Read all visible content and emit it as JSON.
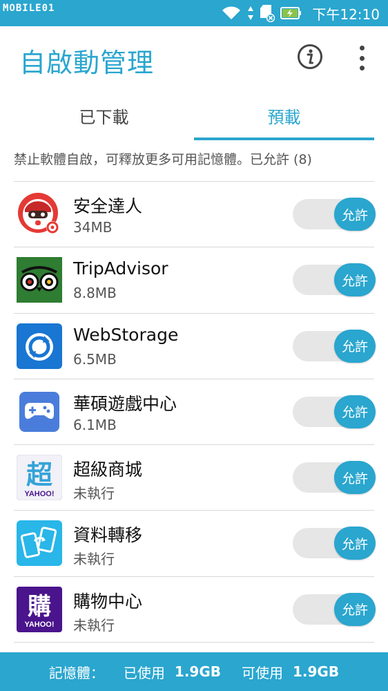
{
  "status_bar": {
    "watermark": "MOBILE01",
    "time": "下午12:10",
    "icons": [
      "wifi-icon",
      "data-arrows-icon",
      "sd-card-icon",
      "battery-charging-icon"
    ]
  },
  "header": {
    "title": "自啟動管理",
    "info_icon": "info-icon",
    "more_icon": "more-vert-icon"
  },
  "tabs": [
    {
      "label": "已下載",
      "active": false
    },
    {
      "label": "預載",
      "active": true
    }
  ],
  "description": "禁止軟體自啟，可釋放更多可用記憶體。已允許 (8)",
  "apps": [
    {
      "name": "安全達人",
      "size": "34MB",
      "toggle_label": "允許",
      "allowed": true,
      "icon": "security-app-icon"
    },
    {
      "name": "TripAdvisor",
      "size": "8.8MB",
      "toggle_label": "允許",
      "allowed": true,
      "icon": "tripadvisor-icon"
    },
    {
      "name": "WebStorage",
      "size": "6.5MB",
      "toggle_label": "允許",
      "allowed": true,
      "icon": "webstorage-icon"
    },
    {
      "name": "華碩遊戲中心",
      "size": "6.1MB",
      "toggle_label": "允許",
      "allowed": true,
      "icon": "game-center-icon"
    },
    {
      "name": "超級商城",
      "size": "未執行",
      "toggle_label": "允許",
      "allowed": true,
      "icon": "yahoo-super-mall-icon",
      "icon_text": "超",
      "icon_brand": "YAHOO!"
    },
    {
      "name": "資料轉移",
      "size": "未執行",
      "toggle_label": "允許",
      "allowed": true,
      "icon": "data-transfer-icon"
    },
    {
      "name": "購物中心",
      "size": "未執行",
      "toggle_label": "允許",
      "allowed": true,
      "icon": "yahoo-shopping-icon",
      "icon_text": "購",
      "icon_brand": "YAHOO!"
    }
  ],
  "footer": {
    "memory_label": "記憶體：",
    "used_label": "已使用",
    "used_value": "1.9GB",
    "free_label": "可使用",
    "free_value": "1.9GB"
  },
  "colors": {
    "accent": "#2aa6cf",
    "toggle_track": "#e6e6e6",
    "divider": "#d8d8d8"
  }
}
